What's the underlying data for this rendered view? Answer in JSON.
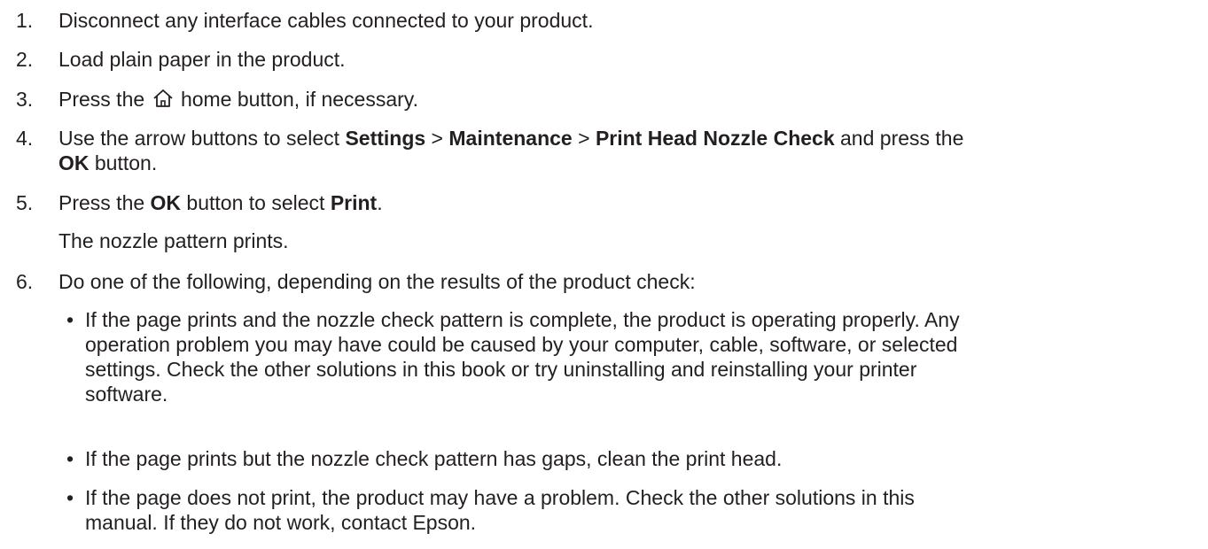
{
  "steps": [
    {
      "num": "1.",
      "text": "Disconnect any interface cables connected to your product."
    },
    {
      "num": "2.",
      "text": "Load plain paper in the product."
    },
    {
      "num": "3.",
      "pre": "Press the",
      "post": "home button, if necessary.",
      "icon": "home-icon"
    },
    {
      "num": "4.",
      "line1": {
        "a": "Use the arrow buttons to select ",
        "b1": "Settings",
        "s1": " > ",
        "b2": "Maintenance",
        "s2": " > ",
        "b3": "Print Head Nozzle Check",
        "c": " and press the"
      },
      "line2": {
        "b": "OK",
        "c": " button."
      }
    },
    {
      "num": "5.",
      "a": "Press the ",
      "b1": "OK",
      "mid": " button to select ",
      "b2": "Print",
      "end": "."
    },
    {
      "sub": "The nozzle pattern prints."
    },
    {
      "num": "6.",
      "text": "Do one of the following, depending on the results of the product check:"
    }
  ],
  "bullets": [
    {
      "lines": [
        "If the page prints and the nozzle check pattern is complete, the product is operating properly. Any",
        "operation problem you may have could be caused by your computer, cable, software, or selected",
        "settings. Check the other solutions in this book or try uninstalling and reinstalling your printer",
        "software."
      ]
    },
    {
      "lines": [
        "If the page prints but the nozzle check pattern has gaps, clean the print head."
      ]
    },
    {
      "lines": [
        "If the page does not print, the product may have a problem. Check the other solutions in this",
        "manual. If they do not work, contact Epson."
      ]
    }
  ],
  "bullet_glyph": "•"
}
